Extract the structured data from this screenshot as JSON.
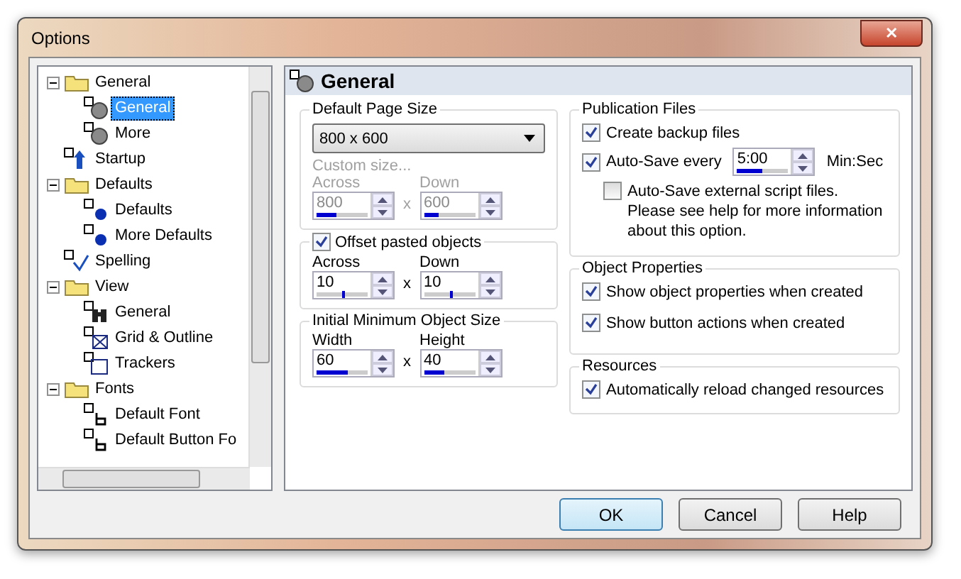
{
  "window": {
    "title": "Options",
    "close": "✕"
  },
  "tree": [
    {
      "label": "General",
      "kind": "folder",
      "expanded": true,
      "selected": false,
      "children": [
        {
          "label": "General",
          "kind": "globe",
          "selected": true
        },
        {
          "label": "More",
          "kind": "globe",
          "selected": false
        }
      ]
    },
    {
      "label": "Startup",
      "kind": "arrow",
      "selected": false
    },
    {
      "label": "Defaults",
      "kind": "folder",
      "expanded": true,
      "selected": false,
      "children": [
        {
          "label": "Defaults",
          "kind": "dot",
          "selected": false
        },
        {
          "label": "More Defaults",
          "kind": "dot",
          "selected": false
        }
      ]
    },
    {
      "label": "Spelling",
      "kind": "check",
      "selected": false
    },
    {
      "label": "View",
      "kind": "folder",
      "expanded": true,
      "selected": false,
      "children": [
        {
          "label": "General",
          "kind": "binoculars",
          "selected": false
        },
        {
          "label": "Grid & Outline",
          "kind": "grid",
          "selected": false
        },
        {
          "label": "Trackers",
          "kind": "tracker",
          "selected": false
        }
      ]
    },
    {
      "label": "Fonts",
      "kind": "folder",
      "expanded": true,
      "selected": false,
      "children": [
        {
          "label": "Default Font",
          "kind": "font",
          "selected": false
        },
        {
          "label": "Default Button Fo",
          "kind": "font",
          "selected": false
        }
      ]
    }
  ],
  "panel": {
    "title": "General",
    "page_size": {
      "legend": "Default Page Size",
      "dropdown": "800 x 600",
      "custom_label": "Custom size...",
      "disabled": true,
      "fields": [
        {
          "label": "Across",
          "value": "800",
          "level": 0.38,
          "kind": "fill"
        },
        {
          "label": "Down",
          "value": "600",
          "level": 0.3,
          "kind": "fill"
        }
      ],
      "times": "x"
    },
    "offset": {
      "legend": "Offset pasted objects",
      "checked": true,
      "fields": [
        {
          "label": "Across",
          "value": "10",
          "level": 0.5,
          "kind": "tick"
        },
        {
          "label": "Down",
          "value": "10",
          "level": 0.5,
          "kind": "tick"
        }
      ],
      "times": "x"
    },
    "min_size": {
      "legend": "Initial Minimum Object Size",
      "fields": [
        {
          "label": "Width",
          "value": "60",
          "level": 0.6,
          "kind": "fill"
        },
        {
          "label": "Height",
          "value": "40",
          "level": 0.4,
          "kind": "fill"
        }
      ],
      "times": "x"
    },
    "publication": {
      "legend": "Publication Files",
      "backup": {
        "label": "Create backup files",
        "checked": true
      },
      "autosave": {
        "label": "Auto-Save every",
        "checked": true,
        "value": "5:00",
        "level": 0.5,
        "unit": "Min:Sec"
      },
      "external": {
        "label": "Auto-Save external script files.",
        "note": "Please see help for more information about this option.",
        "checked": false
      }
    },
    "object_properties": {
      "legend": "Object Properties",
      "items": [
        {
          "label": "Show object properties when created",
          "checked": true
        },
        {
          "label": "Show button actions when created",
          "checked": true
        }
      ]
    },
    "resources": {
      "legend": "Resources",
      "items": [
        {
          "label": "Automatically reload changed resources",
          "checked": true
        }
      ]
    }
  },
  "buttons": [
    {
      "label": "OK",
      "default": true
    },
    {
      "label": "Cancel",
      "default": false
    },
    {
      "label": "Help",
      "default": false
    }
  ]
}
